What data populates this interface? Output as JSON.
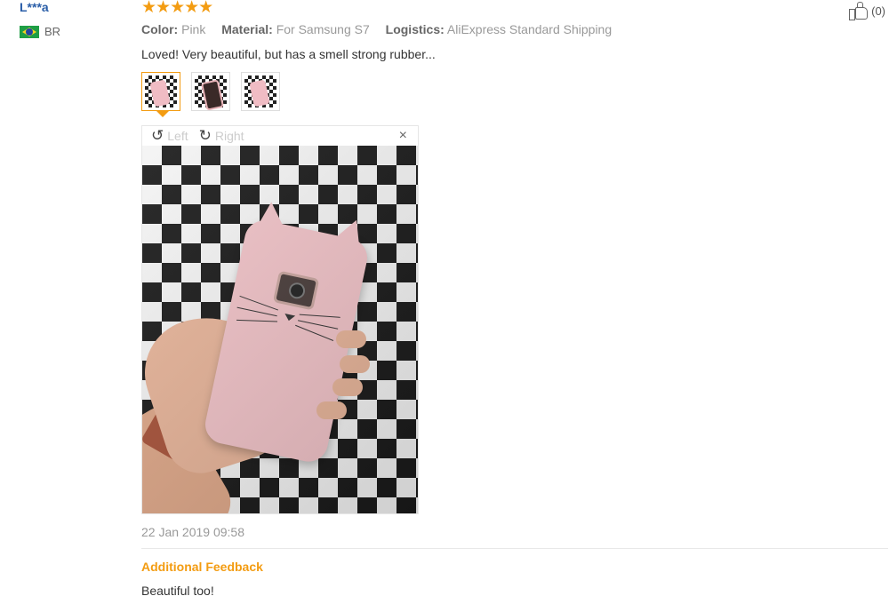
{
  "review": {
    "username": "L***a",
    "country": "BR",
    "rating": 5,
    "stars": "★★★★★",
    "attributes": [
      {
        "key": "Color:",
        "value": "Pink"
      },
      {
        "key": "Material:",
        "value": "For Samsung S7"
      },
      {
        "key": "Logistics:",
        "value": "AliExpress Standard Shipping"
      }
    ],
    "text": "Loved! Very beautiful, but has a smell strong rubber...",
    "helpful_count": "(0)",
    "date": "22 Jan 2019 09:58",
    "additional_feedback_label": "Additional Feedback",
    "additional_feedback_text": "Beautiful too!"
  },
  "viewer": {
    "rotate_left_label": "Left",
    "rotate_right_label": "Right",
    "close_symbol": "×",
    "rotate_left_icon": "↺",
    "rotate_right_icon": "↻"
  },
  "thumbnails": [
    {
      "name": "photo-1",
      "active": true
    },
    {
      "name": "photo-2",
      "active": false
    },
    {
      "name": "photo-3",
      "active": false
    }
  ],
  "colors": {
    "accent": "#f39c12",
    "username": "#2a5ea8",
    "case_pink": "#f1c3c8"
  }
}
